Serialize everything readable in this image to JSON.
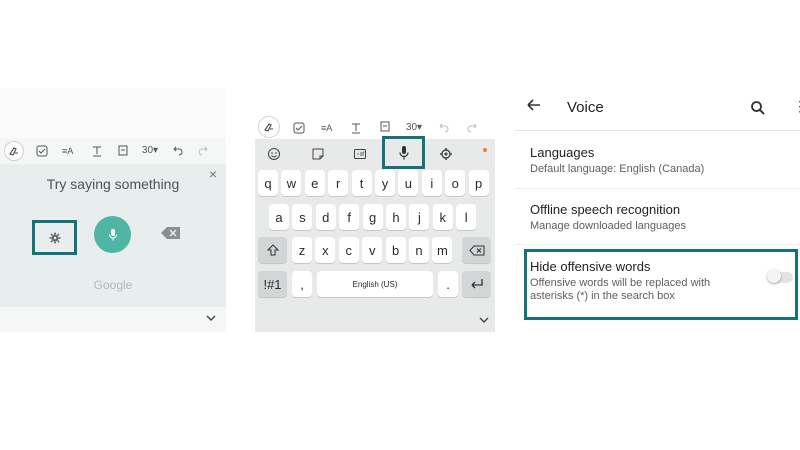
{
  "panel_voice": {
    "prompt": "Try saying something",
    "brand": "Google",
    "close_glyph": "×",
    "toolbar": {
      "font_size": "30▾"
    },
    "icons": [
      "pen-icon",
      "check-icon",
      "text-style-icon",
      "text-format-icon",
      "clipboard-icon",
      "undo-icon",
      "redo-icon",
      "gear-icon",
      "mic-icon",
      "backspace-icon",
      "chevron-down-icon"
    ]
  },
  "panel_keyboard": {
    "toolbar": {
      "font_size": "30▾"
    },
    "rows": [
      [
        "q",
        "w",
        "e",
        "r",
        "t",
        "y",
        "u",
        "i",
        "o",
        "p"
      ],
      [
        "a",
        "s",
        "d",
        "f",
        "g",
        "h",
        "j",
        "k",
        "l"
      ],
      [
        "z",
        "x",
        "c",
        "v",
        "b",
        "n",
        "m"
      ]
    ],
    "bottom": {
      "symbols": "!#1",
      "comma": ",",
      "space": "English (US)",
      "period": "."
    },
    "icons": [
      "emoji-icon",
      "sticker-icon",
      "gif-icon",
      "mic-icon",
      "gear-icon",
      "shift-icon",
      "backspace-icon",
      "enter-icon",
      "chevron-down-icon"
    ],
    "accent_color": "#f07d28"
  },
  "panel_settings": {
    "title": "Voice",
    "items": [
      {
        "title": "Languages",
        "subtitle": "Default language: English (Canada)"
      },
      {
        "title": "Offline speech recognition",
        "subtitle": "Manage downloaded languages"
      },
      {
        "title": "Hide offensive words",
        "subtitle_line1": "Offensive words will be replaced with",
        "subtitle_line2": "asterisks (*) in the search box",
        "toggle_on": false
      }
    ],
    "icons": [
      "back-arrow-icon",
      "search-icon",
      "more-vert-icon"
    ]
  },
  "highlight_color": "#15727a"
}
